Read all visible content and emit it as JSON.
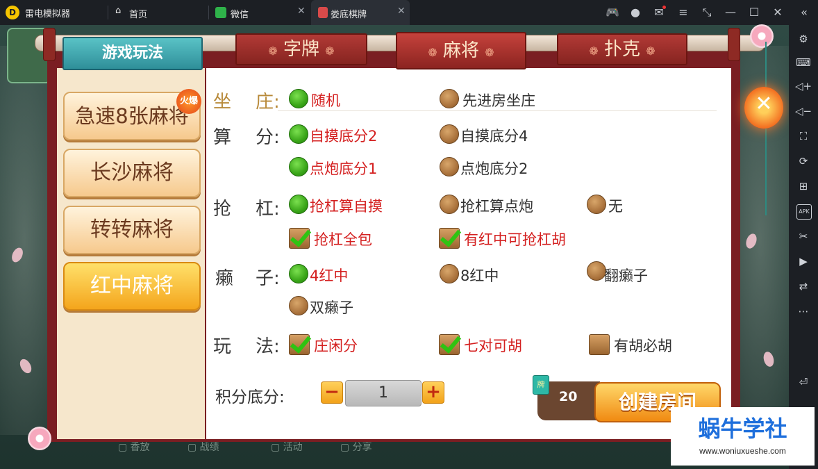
{
  "emulator": {
    "app_name": "雷电模拟器",
    "tabs": [
      {
        "label": "首页",
        "icon": "home-icon"
      },
      {
        "label": "微信",
        "icon": "wechat-icon"
      },
      {
        "label": "娄底棋牌",
        "icon": "game-icon",
        "active": true
      }
    ],
    "sidebar_icons": [
      "settings-icon",
      "keyboard-icon",
      "volume-up-icon",
      "volume-down-icon",
      "fullscreen-icon",
      "rotate-icon",
      "add-window-icon",
      "apk-icon",
      "scissors-icon",
      "record-icon",
      "sync-icon",
      "more-icon",
      "back-icon"
    ],
    "apk_text": "APK"
  },
  "dialog": {
    "play_tab": "游戏玩法",
    "category_tabs": [
      "字牌",
      "麻将",
      "扑克"
    ],
    "selected_category": "麻将",
    "left_menu": [
      "急速8张麻将",
      "长沙麻将",
      "转转麻将",
      "红中麻将"
    ],
    "selected_game": "红中麻将",
    "hot_badge": "火爆",
    "rows": {
      "dealer": {
        "label_a": "坐",
        "label_b": "庄:",
        "options": [
          "随机",
          "先进房坐庄"
        ]
      },
      "scoring": {
        "label_a": "算",
        "label_b": "分:",
        "options": [
          "自摸底分2",
          "自摸底分4",
          "点炮底分1",
          "点炮底分2"
        ]
      },
      "rob_kong": {
        "label_a": "抢",
        "label_b": "杠:",
        "options": [
          "抢杠算自摸",
          "抢杠算点炮",
          "无"
        ],
        "checks": [
          "抢杠全包",
          "有红中可抢杠胡"
        ]
      },
      "wild": {
        "label_a": "癞",
        "label_b": "子:",
        "options": [
          "4红中",
          "8红中",
          "翻癞子",
          "双癞子"
        ]
      },
      "rules": {
        "label_a": "玩",
        "label_b": "法:",
        "checks": [
          "庄闲分",
          "七对可胡",
          "有胡必胡"
        ]
      }
    },
    "score_base": {
      "label": "积分底分:",
      "minus": "−",
      "plus": "+",
      "value": "1"
    },
    "room_cost": "20",
    "card_icon_text": "牌",
    "create_button": "创建房间",
    "close_icon": "close-icon"
  },
  "watermark": {
    "title": "蜗牛学社",
    "url": "www.woniuxueshe.com"
  },
  "colors": {
    "selected_text": "#d42020",
    "dialog_frame": "#7a1e22",
    "accent_green": "#3aa619"
  }
}
